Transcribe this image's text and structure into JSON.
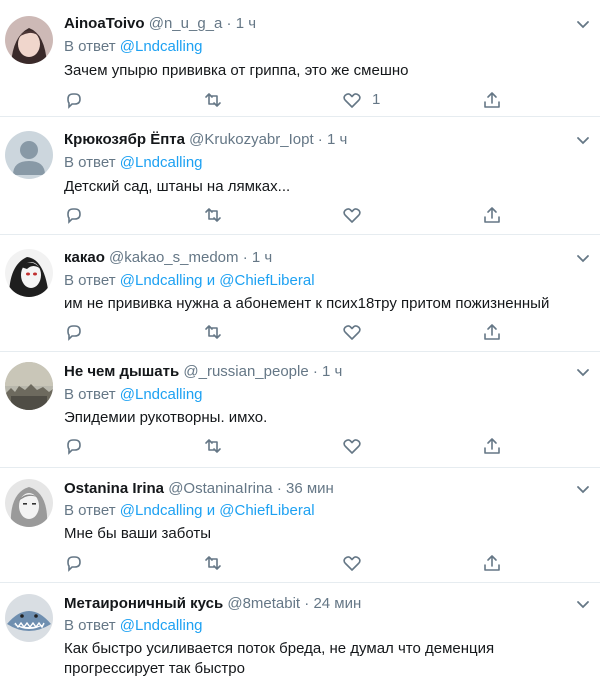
{
  "tweets": [
    {
      "name": "AinoaToivo",
      "handle": "@n_u_g_a",
      "separator": "·",
      "time": "1 ч",
      "reply_prefix": "В ответ",
      "mention1": "@Lndcalling",
      "conjunction": "",
      "mention2": "",
      "text": "Зачем упырю прививка от гриппа, это же смешно",
      "like_count": "1",
      "avatar_icon": "woman-face-photo"
    },
    {
      "name": "Крюкозябр Ёпта",
      "handle": "@Krukozyabr_Iopt",
      "separator": "·",
      "time": "1 ч",
      "reply_prefix": "В ответ",
      "mention1": "@Lndcalling",
      "conjunction": "",
      "mention2": "",
      "text": "Детский сад, штаны на лямках...",
      "like_count": "",
      "avatar_icon": "default-user-silhouette"
    },
    {
      "name": "какао",
      "handle": "@kakao_s_medom",
      "separator": "·",
      "time": "1 ч",
      "reply_prefix": "В ответ",
      "mention1": "@Lndcalling",
      "conjunction": "и",
      "mention2": "@ChiefLiberal",
      "text": "им не прививка нужна а абонемент к псих18тру притом пожизненный",
      "like_count": "",
      "avatar_icon": "anime-girl-photo"
    },
    {
      "name": "Не чем дышать",
      "handle": "@_russian_people",
      "separator": "·",
      "time": "1 ч",
      "reply_prefix": "В ответ",
      "mention1": "@Lndcalling",
      "conjunction": "",
      "mention2": "",
      "text": "Эпидемии рукотворны. имхо.",
      "like_count": "",
      "avatar_icon": "city-smog-photo"
    },
    {
      "name": "Ostanina Irina",
      "handle": "@OstaninaIrina",
      "separator": "·",
      "time": "36 мин",
      "reply_prefix": "В ответ",
      "mention1": "@Lndcalling",
      "conjunction": "и",
      "mention2": "@ChiefLiberal",
      "text": "Мне бы ваши заботы",
      "like_count": "",
      "avatar_icon": "woman-bw-photo"
    },
    {
      "name": "Метаироничный кусь",
      "handle": "@8metabit",
      "separator": "·",
      "time": "24 мин",
      "reply_prefix": "В ответ",
      "mention1": "@Lndcalling",
      "conjunction": "",
      "mention2": "",
      "text": "Как быстро усиливается поток бреда, не думал что деменция прогрессирует так быстро",
      "like_count": "",
      "avatar_icon": "shark-plush-photo"
    }
  ],
  "colors": {
    "link": "#1da1f2",
    "muted": "#657786",
    "text": "#14171a",
    "divider": "#e6ecf0"
  }
}
